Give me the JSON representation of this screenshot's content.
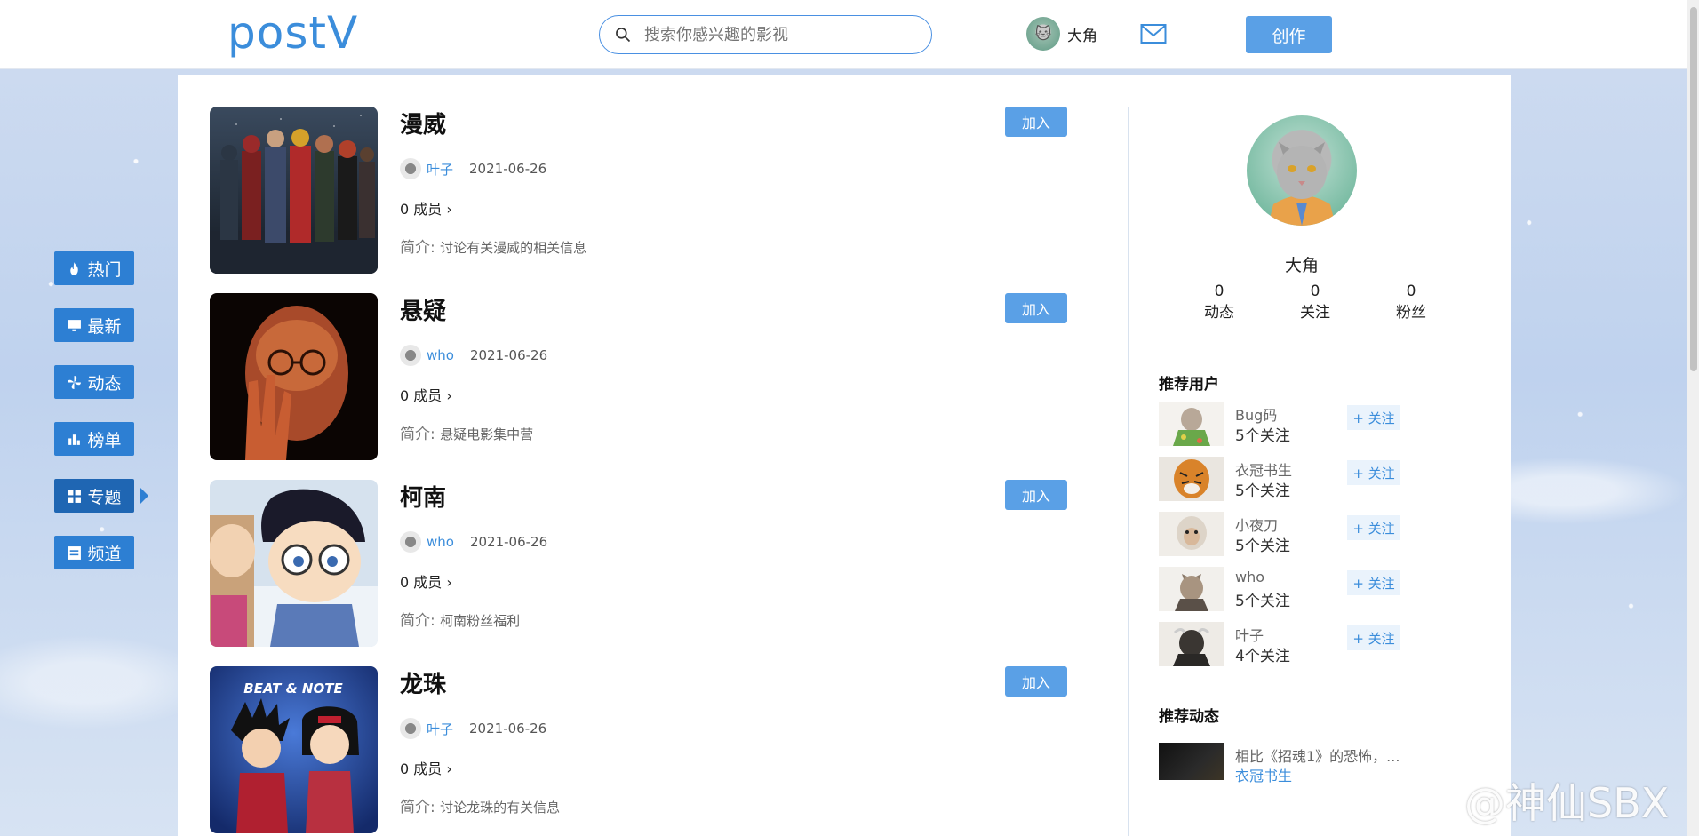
{
  "header": {
    "logo": "postV",
    "search_placeholder": "搜索你感兴趣的影视",
    "user_name": "大角",
    "create_label": "创作"
  },
  "nav": [
    {
      "label": "热门",
      "icon": "fire-icon"
    },
    {
      "label": "最新",
      "icon": "monitor-icon"
    },
    {
      "label": "动态",
      "icon": "pinwheel-icon"
    },
    {
      "label": "榜单",
      "icon": "bar-chart-icon"
    },
    {
      "label": "专题",
      "icon": "grid-icon"
    },
    {
      "label": "频道",
      "icon": "list-icon"
    }
  ],
  "active_nav": "专题",
  "topics": [
    {
      "title": "漫威",
      "author": "叶子",
      "date": "2021-06-26",
      "members": "0 成员",
      "desc_prefix": "简介: ",
      "desc": "讨论有关漫威的相关信息",
      "join_label": "加入",
      "thumb": "marvel"
    },
    {
      "title": "悬疑",
      "author": "who",
      "date": "2021-06-26",
      "members": "0 成员",
      "desc_prefix": "简介: ",
      "desc": "悬疑电影集中营",
      "join_label": "加入",
      "thumb": "mystery"
    },
    {
      "title": "柯南",
      "author": "who",
      "date": "2021-06-26",
      "members": "0 成员",
      "desc_prefix": "简介: ",
      "desc": "柯南粉丝福利",
      "join_label": "加入",
      "thumb": "conan"
    },
    {
      "title": "龙珠",
      "author": "叶子",
      "date": "2021-06-26",
      "members": "0 成员",
      "desc_prefix": "简介: ",
      "desc": "讨论龙珠的有关信息",
      "join_label": "加入",
      "thumb": "dragonball",
      "thumb_caption": "BEAT & NOTE"
    }
  ],
  "profile": {
    "name": "大角",
    "stats": [
      {
        "value": "0",
        "label": "动态"
      },
      {
        "value": "0",
        "label": "关注"
      },
      {
        "value": "0",
        "label": "粉丝"
      }
    ]
  },
  "recommend_users_title": "推荐用户",
  "recommend_users": [
    {
      "name": "Bug码",
      "follow_count": "5个关注",
      "button": "+ 关注"
    },
    {
      "name": "衣冠书生",
      "follow_count": "5个关注",
      "button": "+ 关注"
    },
    {
      "name": "小夜刀",
      "follow_count": "5个关注",
      "button": "+ 关注"
    },
    {
      "name": "who",
      "follow_count": "5个关注",
      "button": "+ 关注"
    },
    {
      "name": "叶子",
      "follow_count": "4个关注",
      "button": "+ 关注"
    }
  ],
  "recommend_posts_title": "推荐动态",
  "recommend_posts": [
    {
      "text": "相比《招魂1》的恐怖，...",
      "author": "衣冠书生"
    }
  ],
  "watermark": "@神仙SBX",
  "colors": {
    "accent": "#3b8ddb",
    "button": "#5aa0e6",
    "nav": "#2d7fd3"
  }
}
